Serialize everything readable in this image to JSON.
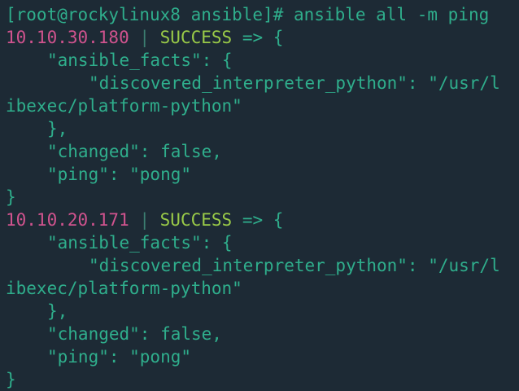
{
  "terminal": {
    "prompt": "[root@rockylinux8 ansible]# ansible all -m ping",
    "blocks": [
      {
        "host": "10.10.30.180",
        "separator": " | ",
        "status": "SUCCESS",
        "arrow": " => {",
        "facts_open": "\"ansible_facts\": {",
        "interpreter_line": "\"discovered_interpreter_python\": \"/usr/l",
        "interpreter_wrap": "ibexec/platform-python\"",
        "facts_close": "},",
        "changed": "\"changed\": false,",
        "ping": "\"ping\": \"pong\"",
        "close": "}"
      },
      {
        "host": "10.10.20.171",
        "separator": " | ",
        "status": "SUCCESS",
        "arrow": " => {",
        "facts_open": "\"ansible_facts\": {",
        "interpreter_line": "\"discovered_interpreter_python\": \"/usr/l",
        "interpreter_wrap": "ibexec/platform-python\"",
        "facts_close": "},",
        "changed": "\"changed\": false,",
        "ping": "\"ping\": \"pong\"",
        "close": "}"
      }
    ],
    "colors": {
      "background": "#1d2a35",
      "text": "#2fae8c",
      "host": "#d0538e",
      "success": "#9acb48"
    }
  }
}
